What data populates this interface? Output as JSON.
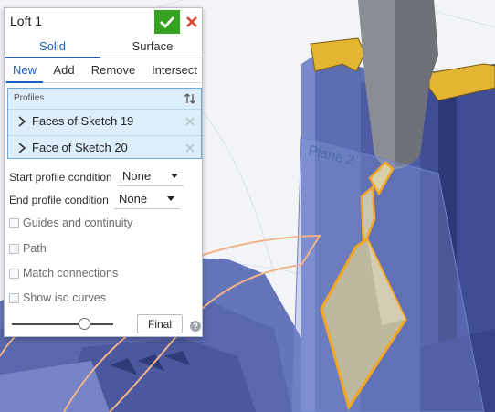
{
  "dialog": {
    "title": "Loft 1",
    "accept_icon": "checkmark-icon",
    "cancel_icon": "close-icon",
    "tabs": [
      {
        "label": "Solid",
        "active": true
      },
      {
        "label": "Surface",
        "active": false
      }
    ],
    "operations": [
      {
        "label": "New",
        "active": true
      },
      {
        "label": "Add",
        "active": false
      },
      {
        "label": "Remove",
        "active": false
      },
      {
        "label": "Intersect",
        "active": false
      }
    ],
    "profiles": {
      "label": "Profiles",
      "sort_icon": "sort-arrows-icon",
      "items": [
        {
          "label": "Faces of Sketch 19"
        },
        {
          "label": "Face of Sketch 20"
        }
      ]
    },
    "start_condition": {
      "label": "Start profile condition",
      "value": "None"
    },
    "end_condition": {
      "label": "End profile condition",
      "value": "None"
    },
    "options": [
      {
        "label": "Guides and continuity",
        "checked": false
      },
      {
        "label": "Path",
        "checked": false
      },
      {
        "label": "Match connections",
        "checked": false
      },
      {
        "label": "Show iso curves",
        "checked": false
      }
    ],
    "preview_slider": {
      "value": 0.72
    },
    "final_label": "Final",
    "help_icon": "?"
  },
  "viewport": {
    "plane_label": "Plane 2"
  },
  "colors": {
    "accent": "#1c5fbe",
    "accept_green": "#35a31f",
    "cancel_red": "#d64530",
    "profiles_bg": "#dbeefa",
    "model_blue": "#5566a8",
    "highlight_orange": "#f5a623",
    "sketch_curve": "#f2b183"
  }
}
